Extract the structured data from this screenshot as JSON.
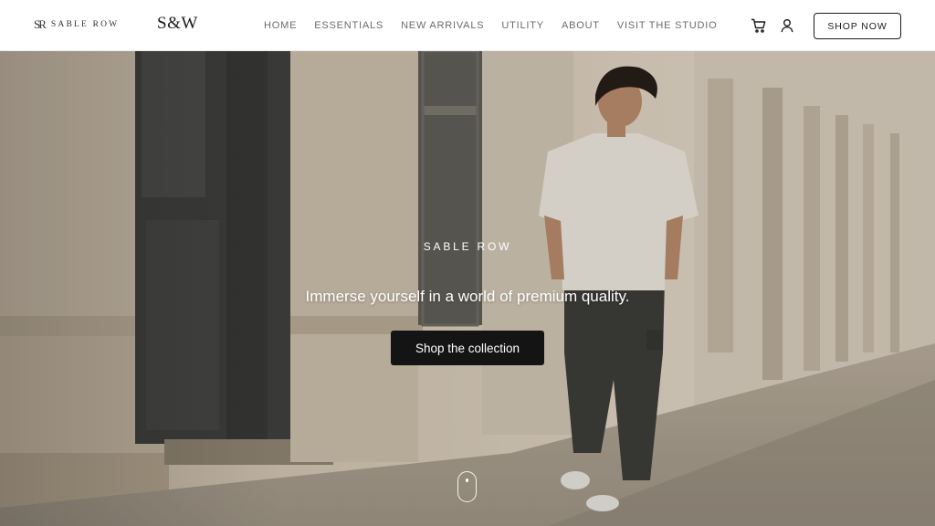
{
  "header": {
    "brand_mark": "SR",
    "brand_name": "SABLE ROW",
    "monogram": "S&W",
    "nav": [
      {
        "label": "HOME"
      },
      {
        "label": "ESSENTIALS"
      },
      {
        "label": "NEW ARRIVALS"
      },
      {
        "label": "UTILITY"
      },
      {
        "label": "ABOUT"
      },
      {
        "label": "VISIT THE STUDIO"
      }
    ],
    "icons": {
      "cart": "cart-icon",
      "account": "user-icon"
    },
    "shop_now_label": "SHOP NOW"
  },
  "hero": {
    "eyebrow": "SABLE ROW",
    "tagline": "Immerse yourself in a world of premium quality.",
    "cta_label": "Shop the collection",
    "scroll_icon": "mouse-scroll-icon"
  },
  "colors": {
    "header_bg": "#ffffff",
    "nav_text": "#6b6b6b",
    "cta_bg": "#141414",
    "hero_text": "#ffffff"
  }
}
